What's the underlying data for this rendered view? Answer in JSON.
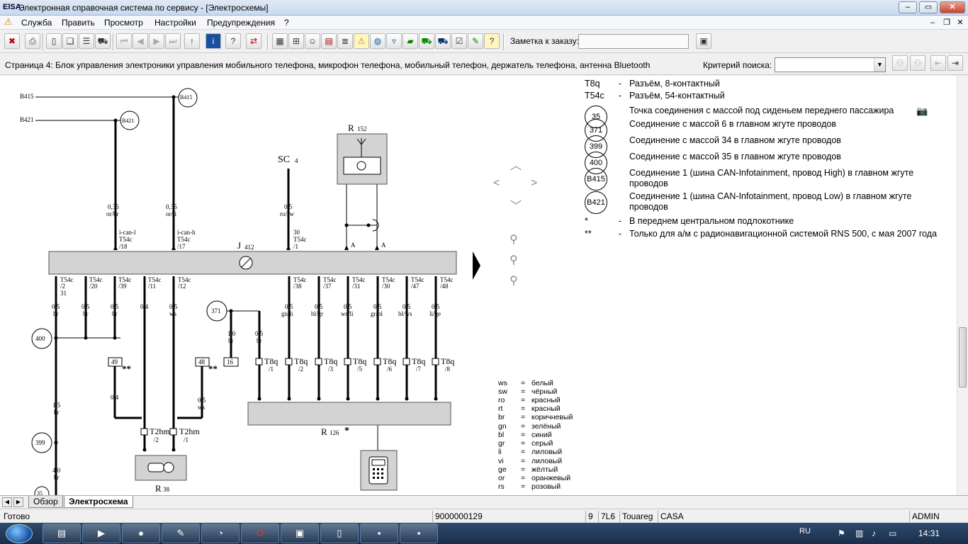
{
  "window": {
    "title": "Электронная справочная система по сервису - [Электросхемы]",
    "app_icon": "ElSA"
  },
  "menu": [
    "Служба",
    "Править",
    "Просмотр",
    "Настройки",
    "Предупреждения",
    "?"
  ],
  "toolbar": {
    "note_label": "Заметка к заказу:",
    "note_value": ""
  },
  "pagebar": {
    "title": "Страница 4: Блок управления электроники управления мобильного телефона, микрофон телефона, мобильный телефон, держатель телефона, антенна Bluetooth",
    "search_label": "Критерий поиска:",
    "search_value": ""
  },
  "legend": [
    {
      "code": "T8q",
      "desc": "Разъём, 8-контактный"
    },
    {
      "code": "T54c",
      "desc": "Разъём, 54-контактный"
    }
  ],
  "legend_circles": [
    {
      "code": "35",
      "desc": "Точка соединения с массой под сиденьем переднего пассажира"
    },
    {
      "code": "371",
      "desc": "Соединение с массой 6 в главном жгуте проводов"
    },
    {
      "code": "399",
      "desc": "Соединение с массой 34 в главном жгуте проводов"
    },
    {
      "code": "400",
      "desc": "Соединение с массой 35 в главном жгуте проводов"
    },
    {
      "code": "B415",
      "desc": "Соединение 1 (шина CAN-Infotainment, провод High) в главном жгуте проводов"
    },
    {
      "code": "B421",
      "desc": "Соединение 1 (шина CAN-Infotainment, провод Low) в главном жгуте проводов"
    }
  ],
  "legend_notes": [
    {
      "code": "*",
      "desc": "В переднем центральном подлокотнике"
    },
    {
      "code": "**",
      "desc": "Только для а/м с радионавигационной системой RNS 500, с мая 2007 года"
    }
  ],
  "colors": [
    {
      "code": "ws",
      "name": "белый"
    },
    {
      "code": "sw",
      "name": "чёрный"
    },
    {
      "code": "ro",
      "name": "красный"
    },
    {
      "code": "rt",
      "name": "красный"
    },
    {
      "code": "br",
      "name": "коричневый"
    },
    {
      "code": "gn",
      "name": "зелёный"
    },
    {
      "code": "bl",
      "name": "синий"
    },
    {
      "code": "gr",
      "name": "серый"
    },
    {
      "code": "li",
      "name": "лиловый"
    },
    {
      "code": "vi",
      "name": "лиловый"
    },
    {
      "code": "ge",
      "name": "жёлтый"
    },
    {
      "code": "or",
      "name": "оранжевый"
    },
    {
      "code": "rs",
      "name": "розовый"
    }
  ],
  "diagram": {
    "b415": "B415",
    "b421": "B421",
    "sc4": "SC",
    "sc4_num": "4",
    "r152": "R",
    "r152_num": "152",
    "j412": "J",
    "j412_num": "412",
    "r126": "R",
    "r126_num": "126",
    "r38": "R",
    "r38_num": "38",
    "top_wires": [
      {
        "size": "0,35",
        "color": "or/br",
        "sig": "i-can-l",
        "conn": "T54c",
        "pin": "/18"
      },
      {
        "size": "0,35",
        "color": "or/li",
        "sig": "i-can-h",
        "conn": "T54c",
        "pin": "/17"
      },
      {
        "size": "0,5",
        "color": "ro/sw",
        "sig": "30",
        "conn": "T54c",
        "pin": "/1"
      }
    ],
    "a_label": "A",
    "bottom_pins": [
      {
        "conn": "T54c",
        "pin": "/2",
        "extra": "31",
        "size": "0,5",
        "color": "br"
      },
      {
        "conn": "T54c",
        "pin": "/20",
        "size": "0,5",
        "color": "br"
      },
      {
        "conn": "T54c",
        "pin": "/39",
        "size": "0,5",
        "color": "br"
      },
      {
        "conn": "T54c",
        "pin": "/11",
        "size": "0,4",
        "color": ""
      },
      {
        "conn": "T54c",
        "pin": "/12",
        "size": "0,5",
        "color": "ws"
      },
      {
        "conn": "T54c",
        "pin": "/38",
        "size": "0,5",
        "color": "gn/li"
      },
      {
        "conn": "T54c",
        "pin": "/37",
        "size": "0,5",
        "color": "bl/gr"
      },
      {
        "conn": "T54c",
        "pin": "/31",
        "size": "0,5",
        "color": "ws/li"
      },
      {
        "conn": "T54c",
        "pin": "/30",
        "size": "0,5",
        "color": "gr/bl"
      },
      {
        "conn": "T54c",
        "pin": "/47",
        "size": "0,5",
        "color": "bl/ws"
      },
      {
        "conn": "T54c",
        "pin": "/48",
        "size": "0,5",
        "color": "li/ge"
      }
    ],
    "t8q_pins": [
      "/1",
      "/2",
      "/3",
      "/5",
      "/6",
      "/7",
      "/8"
    ],
    "t8q": "T8q",
    "t2hm": "T2hm",
    "t2hm_pins": [
      "/2",
      "/1"
    ],
    "grounds": [
      "400",
      "399",
      "371",
      "35"
    ],
    "w400": {
      "size": "1,5",
      "color": "br"
    },
    "w399": {
      "size": "4,0",
      "color": "br"
    },
    "w371a": {
      "size": "1,0",
      "color": "br"
    },
    "w371b": {
      "size": "0,5",
      "color": "br"
    },
    "w49": {
      "size": "0,4",
      "color": ""
    },
    "w48": {
      "size": "0,5",
      "color": "ws"
    },
    "box49": "49",
    "box48": "48",
    "box16": "16",
    "stars2": "**",
    "star1": "*"
  },
  "tabs": [
    "Обзор",
    "Электросхема"
  ],
  "status": {
    "left": "Готово",
    "order": "9000000129",
    "c1": "9",
    "c2": "7L6",
    "c3": "Touareg",
    "c4": "CASA",
    "c5": "ADMIN"
  },
  "taskbar": {
    "lang": "RU",
    "time": "14:31"
  }
}
